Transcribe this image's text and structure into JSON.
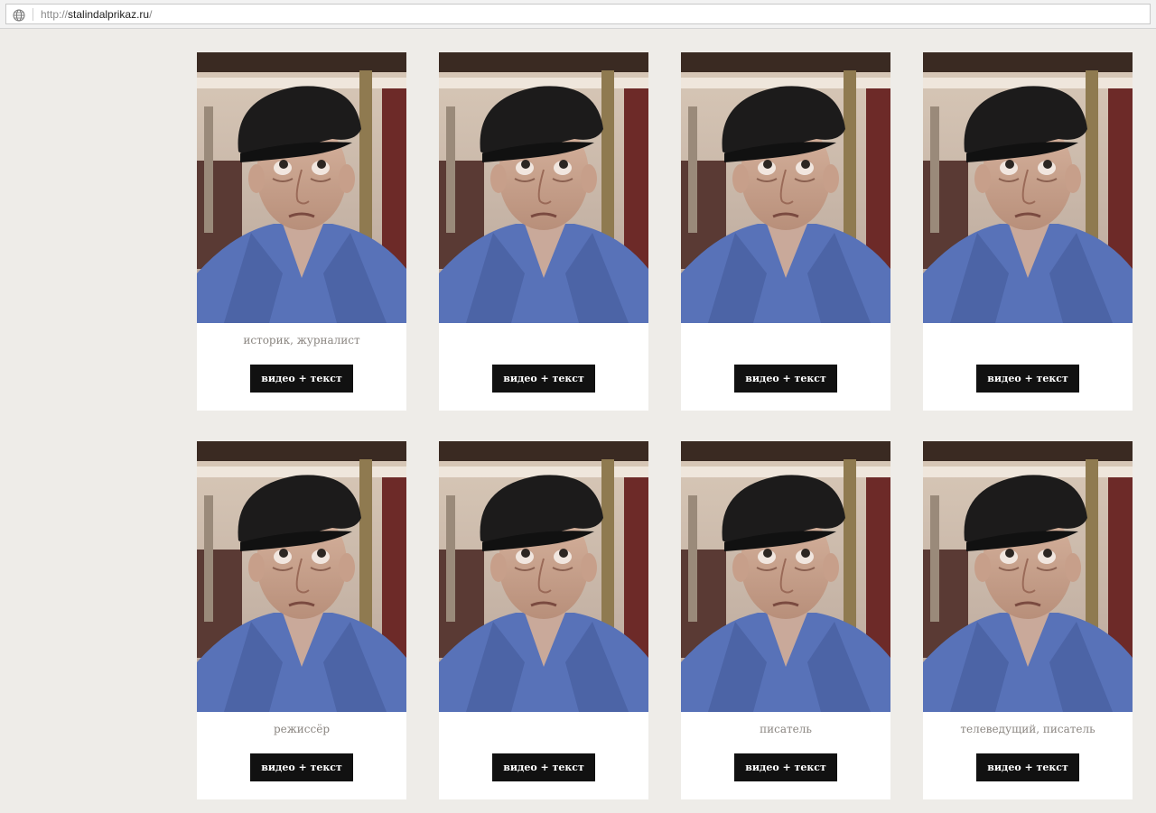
{
  "browser": {
    "url_scheme": "http://",
    "url_host": "stalindalprikaz.ru",
    "url_path": "/"
  },
  "cards": [
    {
      "role": "историк, журналист",
      "button": "видео + текст"
    },
    {
      "role": "",
      "button": "видео + текст"
    },
    {
      "role": "",
      "button": "видео + текст"
    },
    {
      "role": "",
      "button": "видео + текст"
    },
    {
      "role": "режиссёр",
      "button": "видео + текст"
    },
    {
      "role": "",
      "button": "видео + текст"
    },
    {
      "role": "писатель",
      "button": "видео + текст"
    },
    {
      "role": "телеведущий, писатель",
      "button": "видео + текст"
    }
  ]
}
